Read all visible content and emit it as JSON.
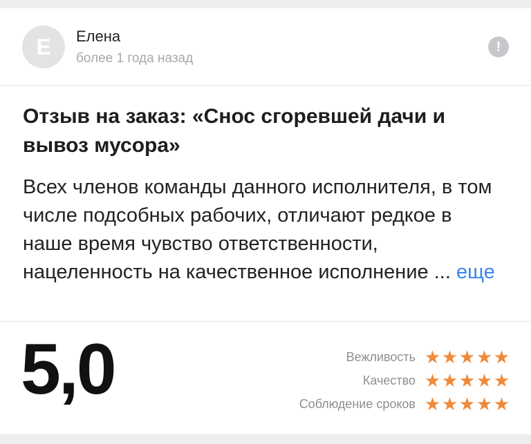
{
  "author": {
    "initial": "Е",
    "name": "Елена",
    "date": "более 1 года назад",
    "avatar_color": "#e3e3e6"
  },
  "report_icon": {
    "icon": "exclamation-icon",
    "glyph": "!"
  },
  "review": {
    "title": "Отзыв на заказ: «Снос сгоревшей дачи и вывоз мусора»",
    "text": "Всех членов команды данного исполнителя, в том числе подсобных рабочих, отличают редкое в наше время чувство ответственности, нацеленность на качественное исполнение ...",
    "more_label": "еще"
  },
  "rating": {
    "overall": "5,0",
    "star_color": "#ef8a3a",
    "criteria": [
      {
        "label": "Вежливость",
        "stars": 5
      },
      {
        "label": "Качество",
        "stars": 5
      },
      {
        "label": "Соблюдение сроков",
        "stars": 5
      }
    ]
  }
}
